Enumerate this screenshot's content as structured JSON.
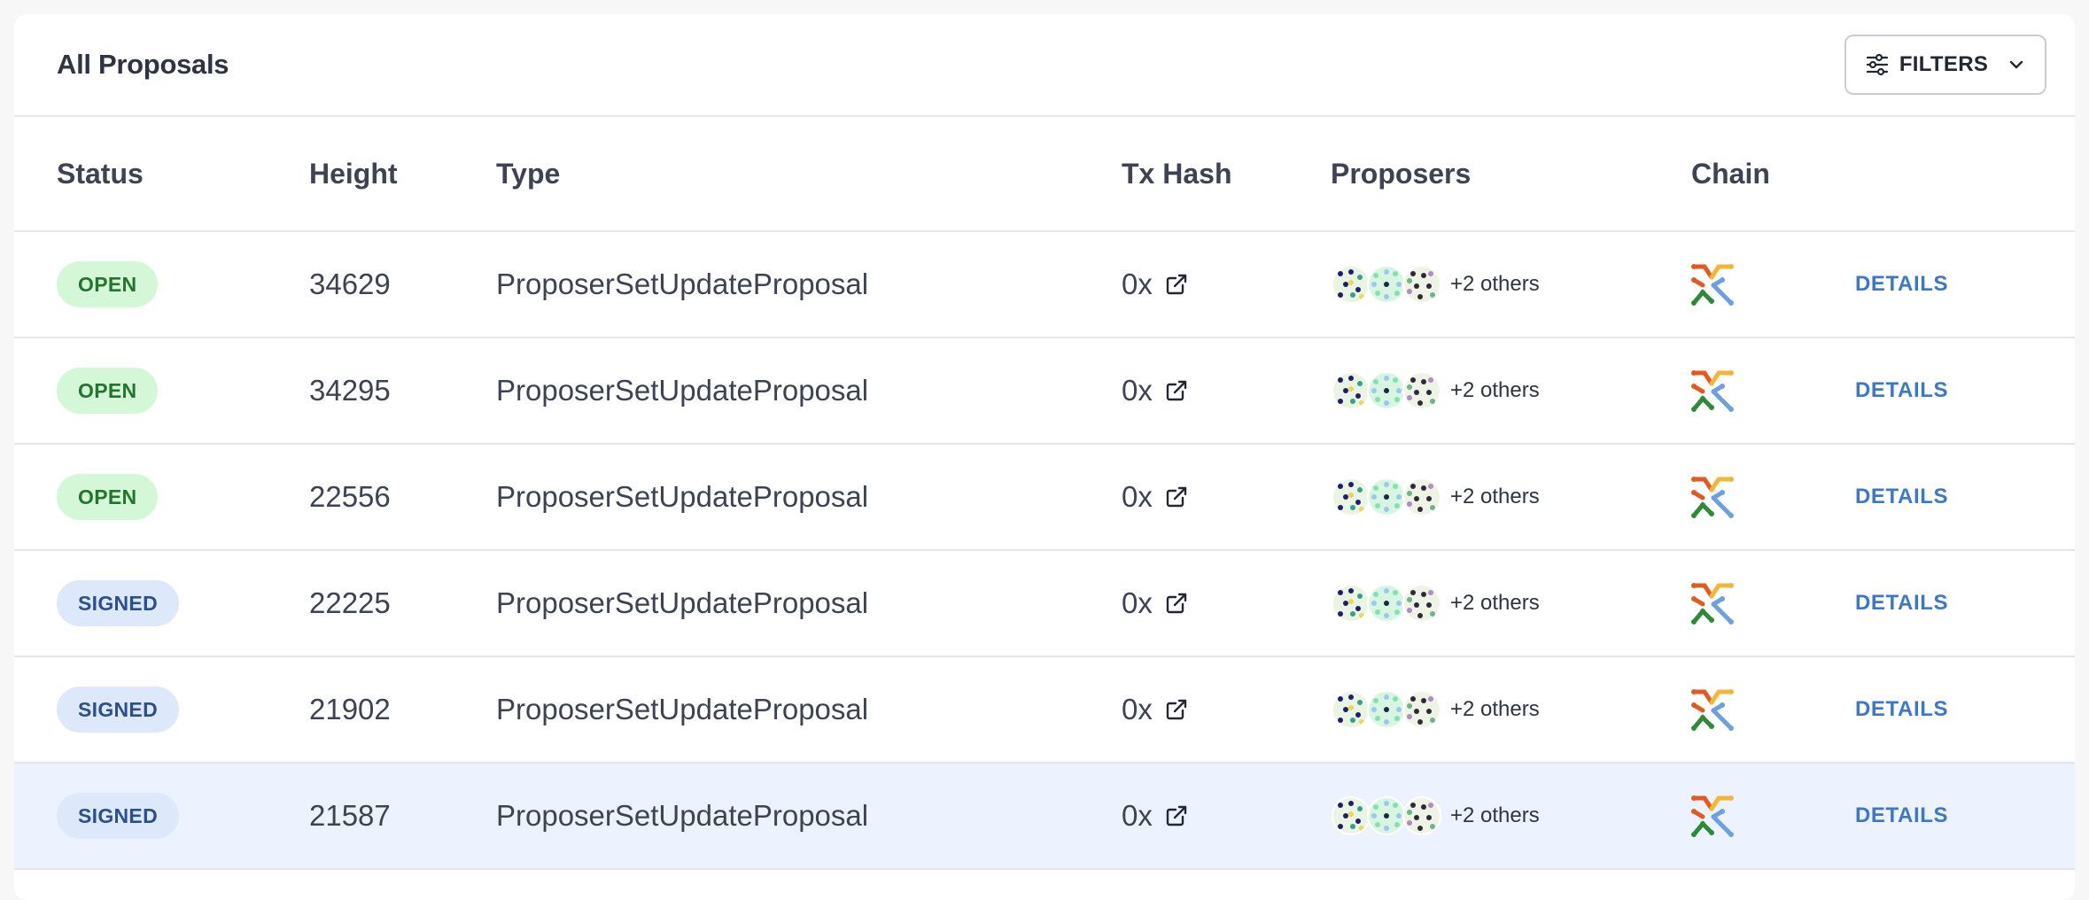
{
  "header": {
    "title": "All Proposals",
    "filters_label": "FILTERS",
    "filters_icon": "sliders-icon",
    "dropdown_icon": "chevron-down-icon"
  },
  "columns": {
    "status": "Status",
    "height": "Height",
    "type": "Type",
    "tx_hash": "Tx Hash",
    "proposers": "Proposers",
    "chain": "Chain"
  },
  "rows": [
    {
      "status": "OPEN",
      "status_kind": "open",
      "height": "34629",
      "type": "ProposerSetUpdateProposal",
      "tx_hash": "0x",
      "others": "+2 others",
      "action": "DETAILS",
      "highlighted": false
    },
    {
      "status": "OPEN",
      "status_kind": "open",
      "height": "34295",
      "type": "ProposerSetUpdateProposal",
      "tx_hash": "0x",
      "others": "+2 others",
      "action": "DETAILS",
      "highlighted": false
    },
    {
      "status": "OPEN",
      "status_kind": "open",
      "height": "22556",
      "type": "ProposerSetUpdateProposal",
      "tx_hash": "0x",
      "others": "+2 others",
      "action": "DETAILS",
      "highlighted": false
    },
    {
      "status": "SIGNED",
      "status_kind": "signed",
      "height": "22225",
      "type": "ProposerSetUpdateProposal",
      "tx_hash": "0x",
      "others": "+2 others",
      "action": "DETAILS",
      "highlighted": false
    },
    {
      "status": "SIGNED",
      "status_kind": "signed",
      "height": "21902",
      "type": "ProposerSetUpdateProposal",
      "tx_hash": "0x",
      "others": "+2 others",
      "action": "DETAILS",
      "highlighted": false
    },
    {
      "status": "SIGNED",
      "status_kind": "signed",
      "height": "21587",
      "type": "ProposerSetUpdateProposal",
      "tx_hash": "0x",
      "others": "+2 others",
      "action": "DETAILS",
      "highlighted": true
    }
  ],
  "colors": {
    "open_bg": "#d4f7d8",
    "open_text": "#23752e",
    "signed_bg": "#dde8fb",
    "signed_text": "#2d4f8f",
    "link": "#3d77c6",
    "highlight_row": "#ecf3fe"
  }
}
